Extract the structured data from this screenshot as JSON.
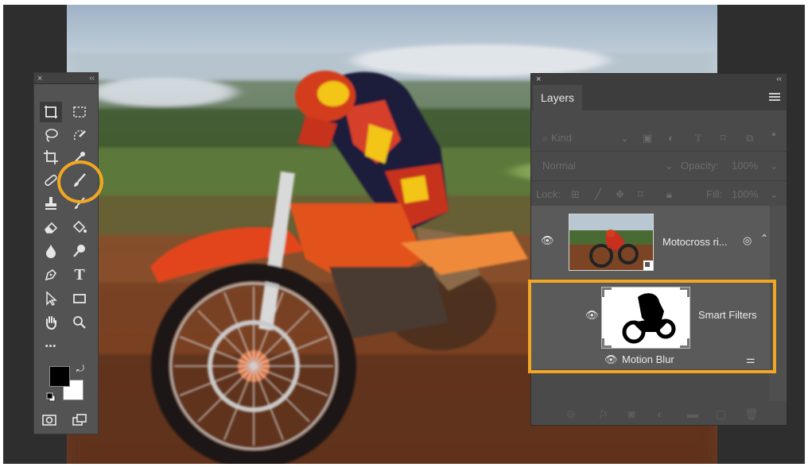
{
  "tools_panel": {
    "close_glyph": "×",
    "collapse_glyph": "‹‹",
    "tool_T": "T",
    "more_glyph": "•••",
    "icons": [
      "artboard-move-icon",
      "marquee-icon",
      "lasso-icon",
      "quick-select-icon",
      "crop-icon",
      "eyedropper-icon",
      "healing-icon",
      "brush-icon",
      "stamp-icon",
      "history-brush-icon",
      "eraser-icon",
      "paint-bucket-icon",
      "blur-drop-icon",
      "dodge-icon",
      "pen-icon",
      "type-icon",
      "path-select-icon",
      "rectangle-icon",
      "hand-icon",
      "zoom-icon",
      "more-icon"
    ]
  },
  "layers_panel": {
    "close_glyph": "×",
    "collapse_glyph": "‹‹",
    "tab": "Layers",
    "filter_kind": "Kind",
    "blend_mode": "Normal",
    "opacity_label": "Opacity:",
    "opacity_value": "100%",
    "lock_label": "Lock:",
    "fill_label": "Fill:",
    "fill_value": "100%",
    "layer_name": "Motocross ri...",
    "smart_filters": "Smart Filters",
    "filter_name": "Motion Blur",
    "footer_fx": "fx"
  },
  "colors": {
    "highlight": "#f2a722",
    "panel_bg": "#4a4a4a",
    "toolbar_bg": "#535353"
  }
}
